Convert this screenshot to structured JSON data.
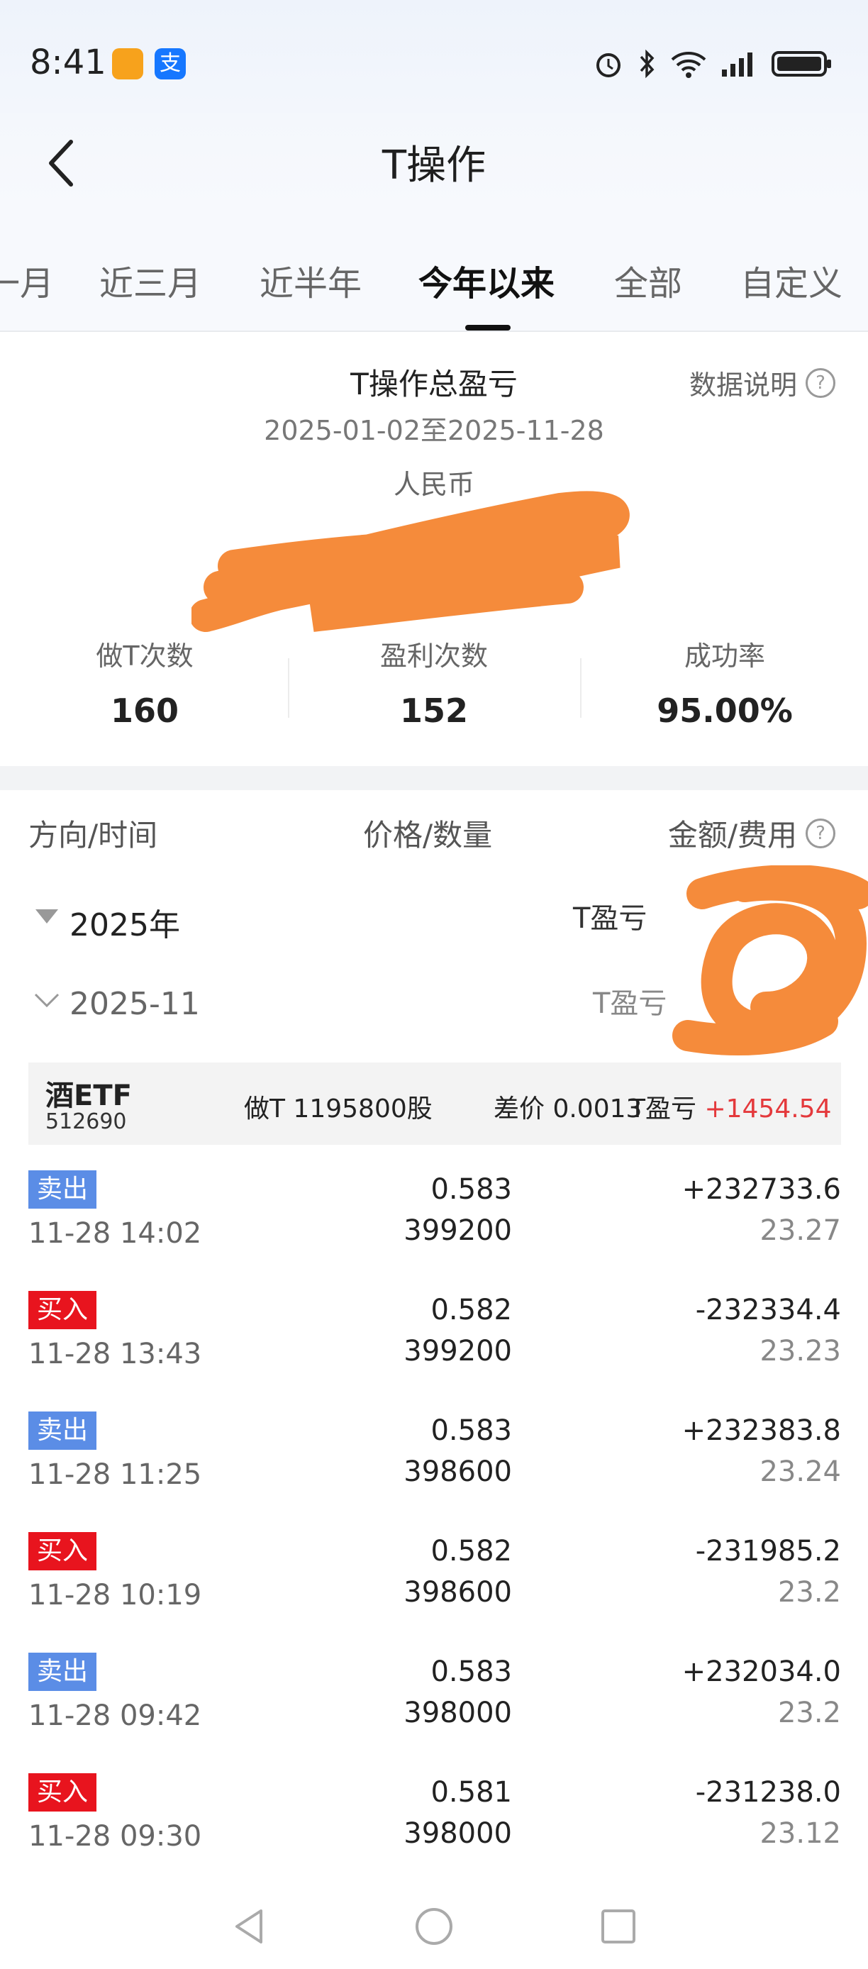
{
  "status": {
    "time": "8:41",
    "icons": [
      "alarm-icon",
      "bluetooth-icon",
      "wifi-icon",
      "signal-icon",
      "battery-icon"
    ]
  },
  "header": {
    "title": "T操作"
  },
  "tabs": [
    {
      "label": "一月",
      "active": false
    },
    {
      "label": "近三月",
      "active": false
    },
    {
      "label": "近半年",
      "active": false
    },
    {
      "label": "今年以来",
      "active": true
    },
    {
      "label": "全部",
      "active": false
    },
    {
      "label": "自定义",
      "active": false
    }
  ],
  "summary": {
    "title": "T操作总盈亏",
    "data_explain": "数据说明",
    "date_range": "2025-01-02至2025-11-28",
    "currency": "人民币",
    "stats": [
      {
        "label": "做T次数",
        "value": "160"
      },
      {
        "label": "盈利次数",
        "value": "152"
      },
      {
        "label": "成功率",
        "value": "95.00%"
      }
    ]
  },
  "list_header": {
    "col1": "方向/时间",
    "col2": "价格/数量",
    "col3": "金额/费用"
  },
  "groups": {
    "year": {
      "label": "2025年",
      "pl_label": "T盈亏"
    },
    "month": {
      "label": "2025-11",
      "pl_label": "T盈亏"
    }
  },
  "etf": {
    "name": "酒ETF",
    "code": "512690",
    "do_t_label": "做T 1195800股",
    "spread_label": "差价 0.0013",
    "pl_label": "T盈亏",
    "pl_value": "+1454.54"
  },
  "trades": [
    {
      "side": "卖出",
      "type": "sell",
      "time": "11-28 14:02",
      "price": "0.583",
      "qty": "399200",
      "amount": "+232733.6",
      "fee": "23.27"
    },
    {
      "side": "买入",
      "type": "buy",
      "time": "11-28 13:43",
      "price": "0.582",
      "qty": "399200",
      "amount": "-232334.4",
      "fee": "23.23"
    },
    {
      "side": "卖出",
      "type": "sell",
      "time": "11-28 11:25",
      "price": "0.583",
      "qty": "398600",
      "amount": "+232383.8",
      "fee": "23.24"
    },
    {
      "side": "买入",
      "type": "buy",
      "time": "11-28 10:19",
      "price": "0.582",
      "qty": "398600",
      "amount": "-231985.2",
      "fee": "23.2"
    },
    {
      "side": "卖出",
      "type": "sell",
      "time": "11-28 09:42",
      "price": "0.583",
      "qty": "398000",
      "amount": "+232034.0",
      "fee": "23.2"
    },
    {
      "side": "买入",
      "type": "buy",
      "time": "11-28 09:30",
      "price": "0.581",
      "qty": "398000",
      "amount": "-231238.0",
      "fee": "23.12"
    }
  ],
  "colors": {
    "sell": "#5b8de6",
    "buy": "#e8141e",
    "profit": "#e4393c",
    "redaction": "#f58b3b"
  }
}
